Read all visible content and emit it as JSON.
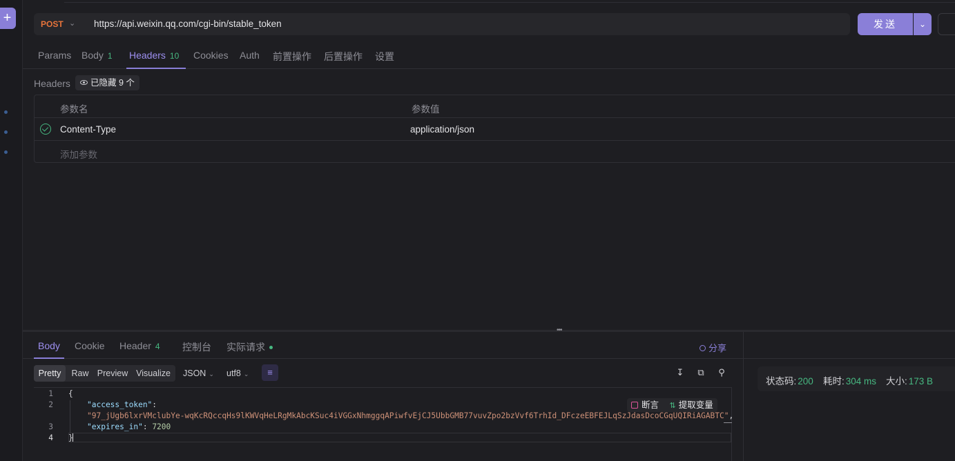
{
  "request": {
    "method": "POST",
    "url": "https://api.weixin.qq.com/cgi-bin/stable_token",
    "send_label": "发送"
  },
  "request_tabs": [
    {
      "label": "Params",
      "badge": ""
    },
    {
      "label": "Body",
      "badge": "1"
    },
    {
      "label": "Headers",
      "badge": "10",
      "active": true
    },
    {
      "label": "Cookies",
      "badge": ""
    },
    {
      "label": "Auth",
      "badge": ""
    },
    {
      "label": "前置操作",
      "badge": ""
    },
    {
      "label": "后置操作",
      "badge": ""
    },
    {
      "label": "设置",
      "badge": ""
    }
  ],
  "headers_section": {
    "label": "Headers",
    "hidden_chip": "已隐藏 9 个",
    "columns": [
      "参数名",
      "参数值"
    ],
    "rows": [
      {
        "name": "Content-Type",
        "value": "application/json",
        "enabled": true
      }
    ],
    "add_placeholder": "添加参数"
  },
  "response_tabs": [
    {
      "label": "Body",
      "active": true
    },
    {
      "label": "Cookie"
    },
    {
      "label": "Header",
      "badge": "4"
    },
    {
      "label": "控制台"
    },
    {
      "label": "实际请求",
      "dot": true
    }
  ],
  "share_label": "分享",
  "format_bar": {
    "modes": [
      "Pretty",
      "Raw",
      "Preview",
      "Visualize"
    ],
    "active_mode": "Pretty",
    "language": "JSON",
    "encoding": "utf8"
  },
  "code_actions": {
    "assert": "断言",
    "extract": "提取变量"
  },
  "response_body": {
    "line_numbers": [
      "1",
      "2",
      "3",
      "4"
    ],
    "open_brace": "{",
    "close_brace": "}",
    "access_token_key": "\"access_token\"",
    "access_token_value": "\"97_jUgb6lxrVMclubYe-wqKcRQccqHs9lKWVqHeLRgMkAbcKSuc4iVGGxNhmggqAPiwfvEjCJ5UbbGMB77vuvZpo2bzVvf6TrhId_DFczeEBFEJLqSzJdasDcoCGqUQIRiAGABTC\"",
    "expires_in_key": "\"expires_in\"",
    "expires_in_value": "7200"
  },
  "status": {
    "code_label": "状态码:",
    "code": "200",
    "time_label": "耗时:",
    "time": "304 ms",
    "size_label": "大小:",
    "size": "173 B"
  },
  "colors": {
    "accent": "#8a7fd8",
    "method_post": "#e8743b",
    "success": "#47b881"
  }
}
